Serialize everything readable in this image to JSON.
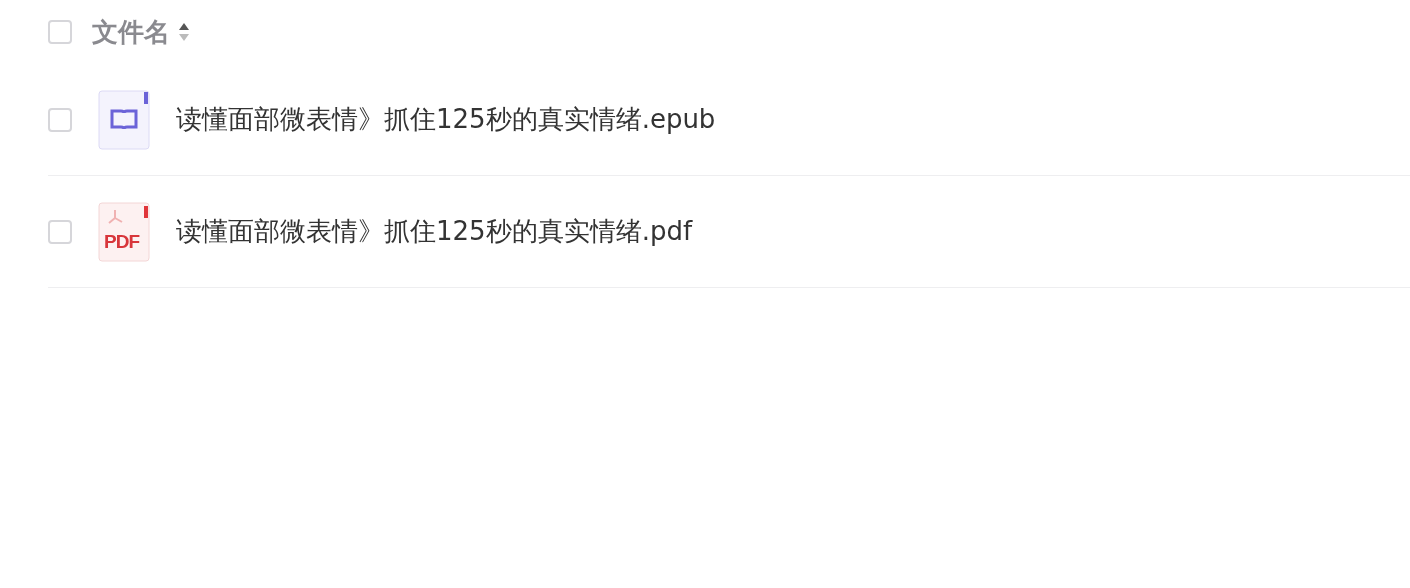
{
  "header": {
    "checked": false,
    "column_label": "文件名"
  },
  "files": [
    {
      "kind": "epub",
      "name": "读懂面部微表情》抓住125秒的真实情绪.epub",
      "checked": false
    },
    {
      "kind": "pdf",
      "name": "读懂面部微表情》抓住125秒的真实情绪.pdf",
      "checked": false,
      "icon_label": "PDF"
    }
  ]
}
